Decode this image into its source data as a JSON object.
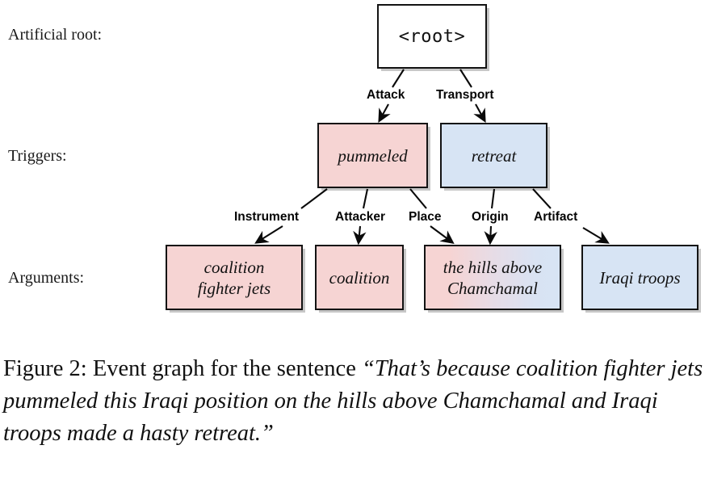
{
  "figure": {
    "row_labels": [
      {
        "key": "root",
        "text": "Artificial root:"
      },
      {
        "key": "triggers",
        "text": "Triggers:"
      },
      {
        "key": "arguments",
        "text": "Arguments:"
      }
    ],
    "root_node": {
      "label": "<root>",
      "fill": "#ffffff"
    },
    "triggers": [
      {
        "id": "pummeled",
        "label": "pummeled",
        "event_type": "Attack",
        "fill": "#f6d4d3"
      },
      {
        "id": "retreat",
        "label": "retreat",
        "event_type": "Transport",
        "fill": "#d7e4f4"
      }
    ],
    "arguments": [
      {
        "id": "coalition-fighter-jets",
        "line1": "coalition",
        "line2": "fighter jets",
        "role": "Instrument",
        "fill": "#f6d4d3"
      },
      {
        "id": "coalition",
        "line1": "coalition",
        "line2": "",
        "role": "Attacker",
        "fill": "#f6d4d3"
      },
      {
        "id": "the-hills-above-chamchamal",
        "line1": "the hills above",
        "line2": "Chamchamal",
        "role": "Place / Origin",
        "fill": "gradient pink-to-blue"
      },
      {
        "id": "iraqi-troops",
        "line1": "Iraqi troops",
        "line2": "",
        "role": "Artifact",
        "fill": "#d7e4f4"
      }
    ],
    "edge_labels": {
      "attack": "Attack",
      "transport": "Transport",
      "instrument": "Instrument",
      "attacker": "Attacker",
      "place": "Place",
      "origin": "Origin",
      "artifact": "Artifact"
    }
  },
  "caption": {
    "lead": "Figure 2:  Event graph for the sentence ",
    "quote": "“That’s because coalition fighter jets pummeled this Iraqi position on the hills above Chamchamal and Iraqi troops made a hasty retreat.”"
  }
}
